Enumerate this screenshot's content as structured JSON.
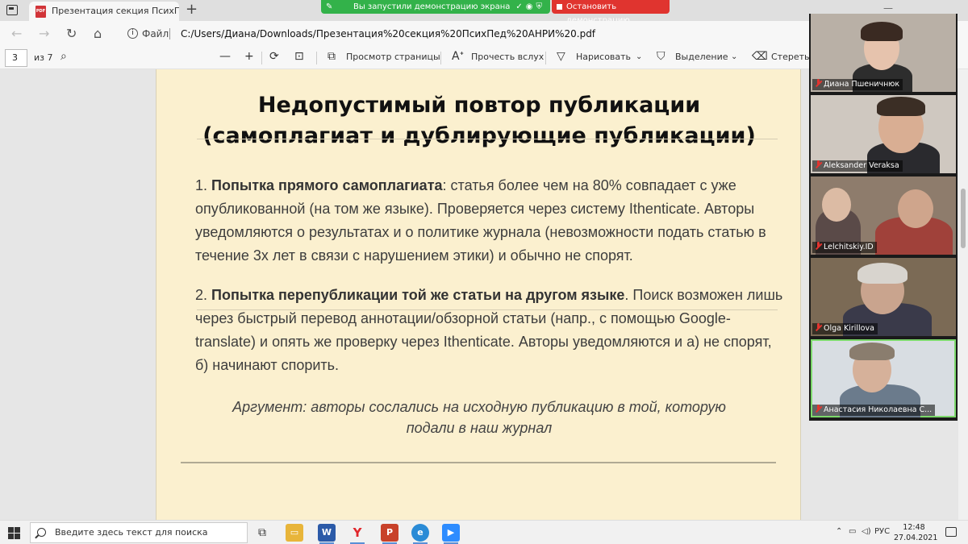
{
  "browser": {
    "tab_title": "Презентация секция ПсихПед АНРИ.pdf",
    "tab_close": "✕",
    "new_tab": "+",
    "url_label": "Файл",
    "url": "C:/Users/Диана/Downloads/Презентация%20секция%20ПсихПед%20АНРИ%20.pdf"
  },
  "screen_share": {
    "status_text": "Вы запустили демонстрацию экрана",
    "stop_label": "Остановить демонстрацию"
  },
  "pdf_toolbar": {
    "page_number": "3",
    "page_total": "из 7",
    "zoom_out": "—",
    "zoom_in": "+",
    "page_view": "Просмотр страницы",
    "read_aloud": "Прочесть вслух",
    "draw": "Нарисовать",
    "highlight": "Выделение",
    "erase": "Стереть"
  },
  "slide": {
    "title_line1": "Недопустимый повтор публикации",
    "title_line2": "(самоплагиат и дублирующие публикации)",
    "p1_number": "1. ",
    "p1_bold": "Попытка прямого самоплагиата",
    "p1_text": ": статья более чем на 80% совпадает с уже опубликованной (на том же языке). Проверяется через систему Ithenticate. Авторы уведомляются о результатах и о политике журнала (невозможности подать статью в течение 3х лет в связи с нарушением этики) и обычно не спорят.",
    "p2_number": "2. ",
    "p2_bold": "Попытка перепубликации той же статьи на другом языке",
    "p2_text": ". Поиск возможен лишь через быстрый перевод аннотации/обзорной статьи (напр., с помощью Google-translate) и опять же проверку через Ithenticate. Авторы уведомляются и а) не спорят, б) начинают спорить.",
    "argument_line1": "Аргумент: авторы сослались на исходную публикацию в той, которую",
    "argument_line2": "подали в наш журнал"
  },
  "participants": [
    {
      "name": "Диана Пшеничнюк",
      "bg": "#b9b0a6",
      "muted": true
    },
    {
      "name": "Aleksander Veraksa",
      "bg": "#cfc8c0",
      "muted": true
    },
    {
      "name": "Lelchitskiy.ID",
      "bg": "#8e7c6c",
      "muted": true
    },
    {
      "name": "Olga Kirillova",
      "bg": "#7b6a55",
      "muted": true
    },
    {
      "name": "Анастасия Николаевна С...",
      "bg": "#d8dde2",
      "muted": true
    }
  ],
  "taskbar": {
    "search_placeholder": "Введите здесь текст для поиска",
    "language": "РУС",
    "time": "12:48",
    "date": "27.04.2021"
  },
  "colors": {
    "slide_bg": "#fbf0cf",
    "share_green": "#33b24a",
    "stop_red": "#e0342f"
  }
}
